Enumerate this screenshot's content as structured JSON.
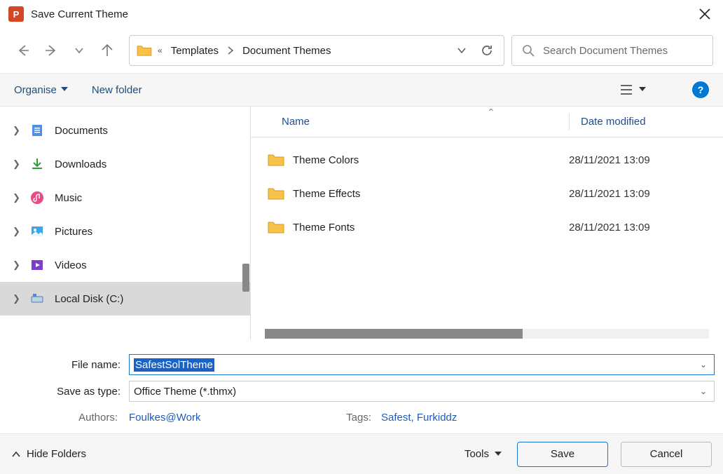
{
  "titlebar": {
    "title": "Save Current Theme"
  },
  "breadcrumb": {
    "seg1": "Templates",
    "seg2": "Document Themes"
  },
  "search": {
    "placeholder": "Search Document Themes"
  },
  "toolbar": {
    "organise": "Organise",
    "new_folder": "New folder"
  },
  "sidebar": {
    "items": [
      {
        "label": "Documents"
      },
      {
        "label": "Downloads"
      },
      {
        "label": "Music"
      },
      {
        "label": "Pictures"
      },
      {
        "label": "Videos"
      },
      {
        "label": "Local Disk (C:)"
      }
    ]
  },
  "columns": {
    "name": "Name",
    "date": "Date modified"
  },
  "rows": [
    {
      "name": "Theme Colors",
      "date": "28/11/2021 13:09"
    },
    {
      "name": "Theme Effects",
      "date": "28/11/2021 13:09"
    },
    {
      "name": "Theme Fonts",
      "date": "28/11/2021 13:09"
    }
  ],
  "form": {
    "filename_label": "File name:",
    "filename_value": "SafestSolTheme",
    "saveas_label": "Save as type:",
    "saveas_value": "Office Theme (*.thmx)",
    "authors_label": "Authors:",
    "authors_value": "Foulkes@Work",
    "tags_label": "Tags:",
    "tags_value": "Safest, Furkiddz"
  },
  "footer": {
    "hide_folders": "Hide Folders",
    "tools": "Tools",
    "save": "Save",
    "cancel": "Cancel"
  }
}
